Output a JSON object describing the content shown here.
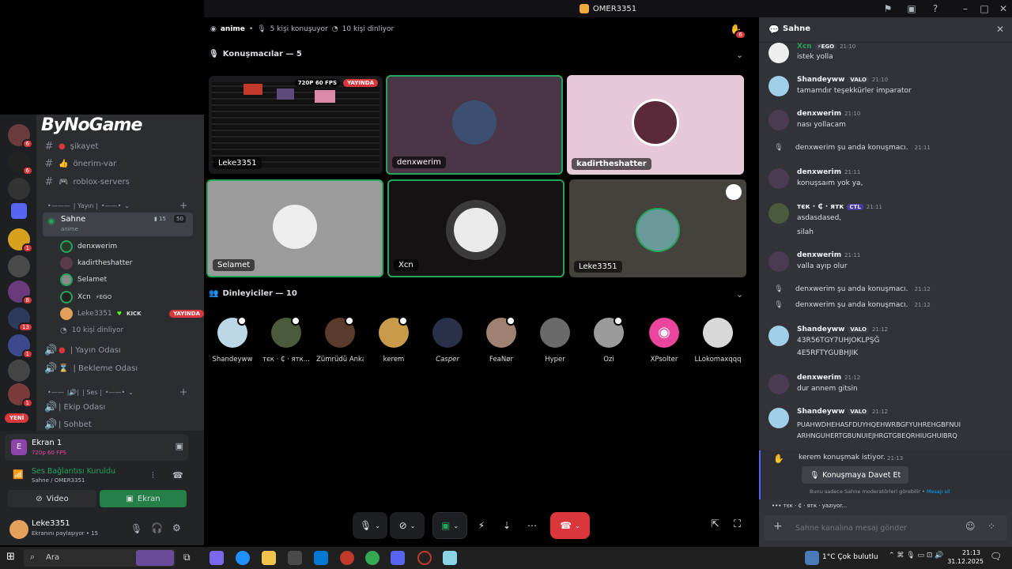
{
  "window": {
    "title": "OMER3351"
  },
  "brand_overlay": "ByNoGame",
  "channels": {
    "text": [
      "şikayet",
      "önerim-var",
      "roblox-servers"
    ],
    "category_yayin": "| Yayın |",
    "stage": {
      "name": "Sahne",
      "topic": "anime",
      "count_a": "15",
      "count_b": "50"
    },
    "stage_users": [
      {
        "name": "denxwerim",
        "extra": ""
      },
      {
        "name": "kadirtheshatter",
        "extra": ""
      },
      {
        "name": "Selamet",
        "extra": ""
      },
      {
        "name": "Xcn",
        "extra": "⚡EGO"
      },
      {
        "name": "Leke3351",
        "extra": "KICK",
        "live": "YAYINDA"
      }
    ],
    "listeners": "10 kişi dinliyor",
    "voice": [
      "| Yayın Odası",
      "| Bekleme Odası"
    ],
    "category_ses": "| Ses |",
    "more": [
      "| Ekip Odası",
      "| Sohbet"
    ],
    "new_badge": "YENİ"
  },
  "guild_badges": [
    "6",
    "1",
    "1",
    "8",
    "13",
    "1",
    "1"
  ],
  "panel": {
    "screen_title": "Ekran 1",
    "screen_sub": "720p 60 FPS",
    "voice_status": "Ses Bağlantısı Kuruldu",
    "voice_channel": "Sahne / OMER3351",
    "video_btn": "Video",
    "screen_btn": "Ekran",
    "user_name": "Leke3351",
    "user_status": "Ekranını paylaşıyor • 15"
  },
  "stage_header": {
    "channel": "anime",
    "speaking": "5 kişi konuşuyor",
    "listening": "10 kişi dinliyor",
    "hand_count": "6"
  },
  "speakers": {
    "title": "Konuşmacılar — 5",
    "stream_badge": "720P 60 FPS",
    "live_badge": "YAYINDA",
    "tiles": [
      "Leke3351",
      "denxwerim",
      "kadirtheshatter",
      "Selamet",
      "Xcn",
      "Leke3351"
    ]
  },
  "audience": {
    "title": "Dinleyiciler — 10",
    "members": [
      "Shandeyww",
      "тєк · ₵ · ятк...",
      "Zümrüdü Anka",
      "kerem",
      "Casper",
      "FeaNør",
      "Hyper",
      "Ozi",
      "XPsolter",
      "LLokomaxqqq"
    ]
  },
  "chat": {
    "title": "Sahne",
    "messages": [
      {
        "user": "Xcn",
        "tag": "⚡EGO",
        "time": "21:10",
        "lines": [
          "istek yolla"
        ]
      },
      {
        "user": "Shandeyww",
        "tag": "VALO",
        "time": "21:10",
        "lines": [
          "tamamdır teşekkürler imparator"
        ]
      },
      {
        "user": "denxwerim",
        "tag": "",
        "time": "21:10",
        "lines": [
          "nası yollacam"
        ]
      },
      {
        "user": "denxwerim",
        "tag": "",
        "time": "21:11",
        "lines": [
          "konuşsaım yok ya,"
        ]
      },
      {
        "user": "тєк · ₵ · ятк",
        "tag": "CTL",
        "time": "21:11",
        "lines": [
          "asdasdased,",
          "silah"
        ]
      },
      {
        "user": "denxwerim",
        "tag": "",
        "time": "21:11",
        "lines": [
          "valla ayıp olur"
        ]
      },
      {
        "user": "Shandeyww",
        "tag": "VALO",
        "time": "21:12",
        "lines": [
          "43R56TGY7UHJOKLPŞĞ",
          "4E5RFTYGUBHJIK"
        ]
      },
      {
        "user": "denxwerim",
        "tag": "",
        "time": "21:12",
        "lines": [
          "dur annem gitsin"
        ]
      },
      {
        "user": "Shandeyww",
        "tag": "VALO",
        "time": "21:12",
        "lines": [
          "PUAHWDHEHASFDUYHQEHWRBGFYUHREHGBFNUI",
          "ARHNGUHERTGBUNUIEJHRGTGBEQRHIUGHUIBRQ"
        ]
      }
    ],
    "system": [
      {
        "text": "denxwerim şu anda konuşmacı.",
        "time": "21:11"
      },
      {
        "text": "denxwerim şu anda konuşmacı.",
        "time": "21:12"
      },
      {
        "text": "denxwerim şu anda konuşmacı.",
        "time": "21:12"
      }
    ],
    "request": {
      "text": "kerem konuşmak istiyor.",
      "time": "21:13",
      "button": "Konuşmaya Davet Et",
      "note": "Bunu sadece Sahne moderatörleri görebilir •",
      "link": "Mesajı sil"
    },
    "typing": "тєк · ₵ · ятк · yazıyor...",
    "placeholder": "Sahne kanalına mesaj gönder"
  },
  "taskbar": {
    "search": "Ara",
    "weather": "1°C  Çok bulutlu",
    "time": "21:13",
    "date": "31.12.2025"
  },
  "colors": {
    "accent": "#5865f2",
    "live": "#da373c",
    "green": "#23a55a",
    "panel_green": "#248046"
  }
}
